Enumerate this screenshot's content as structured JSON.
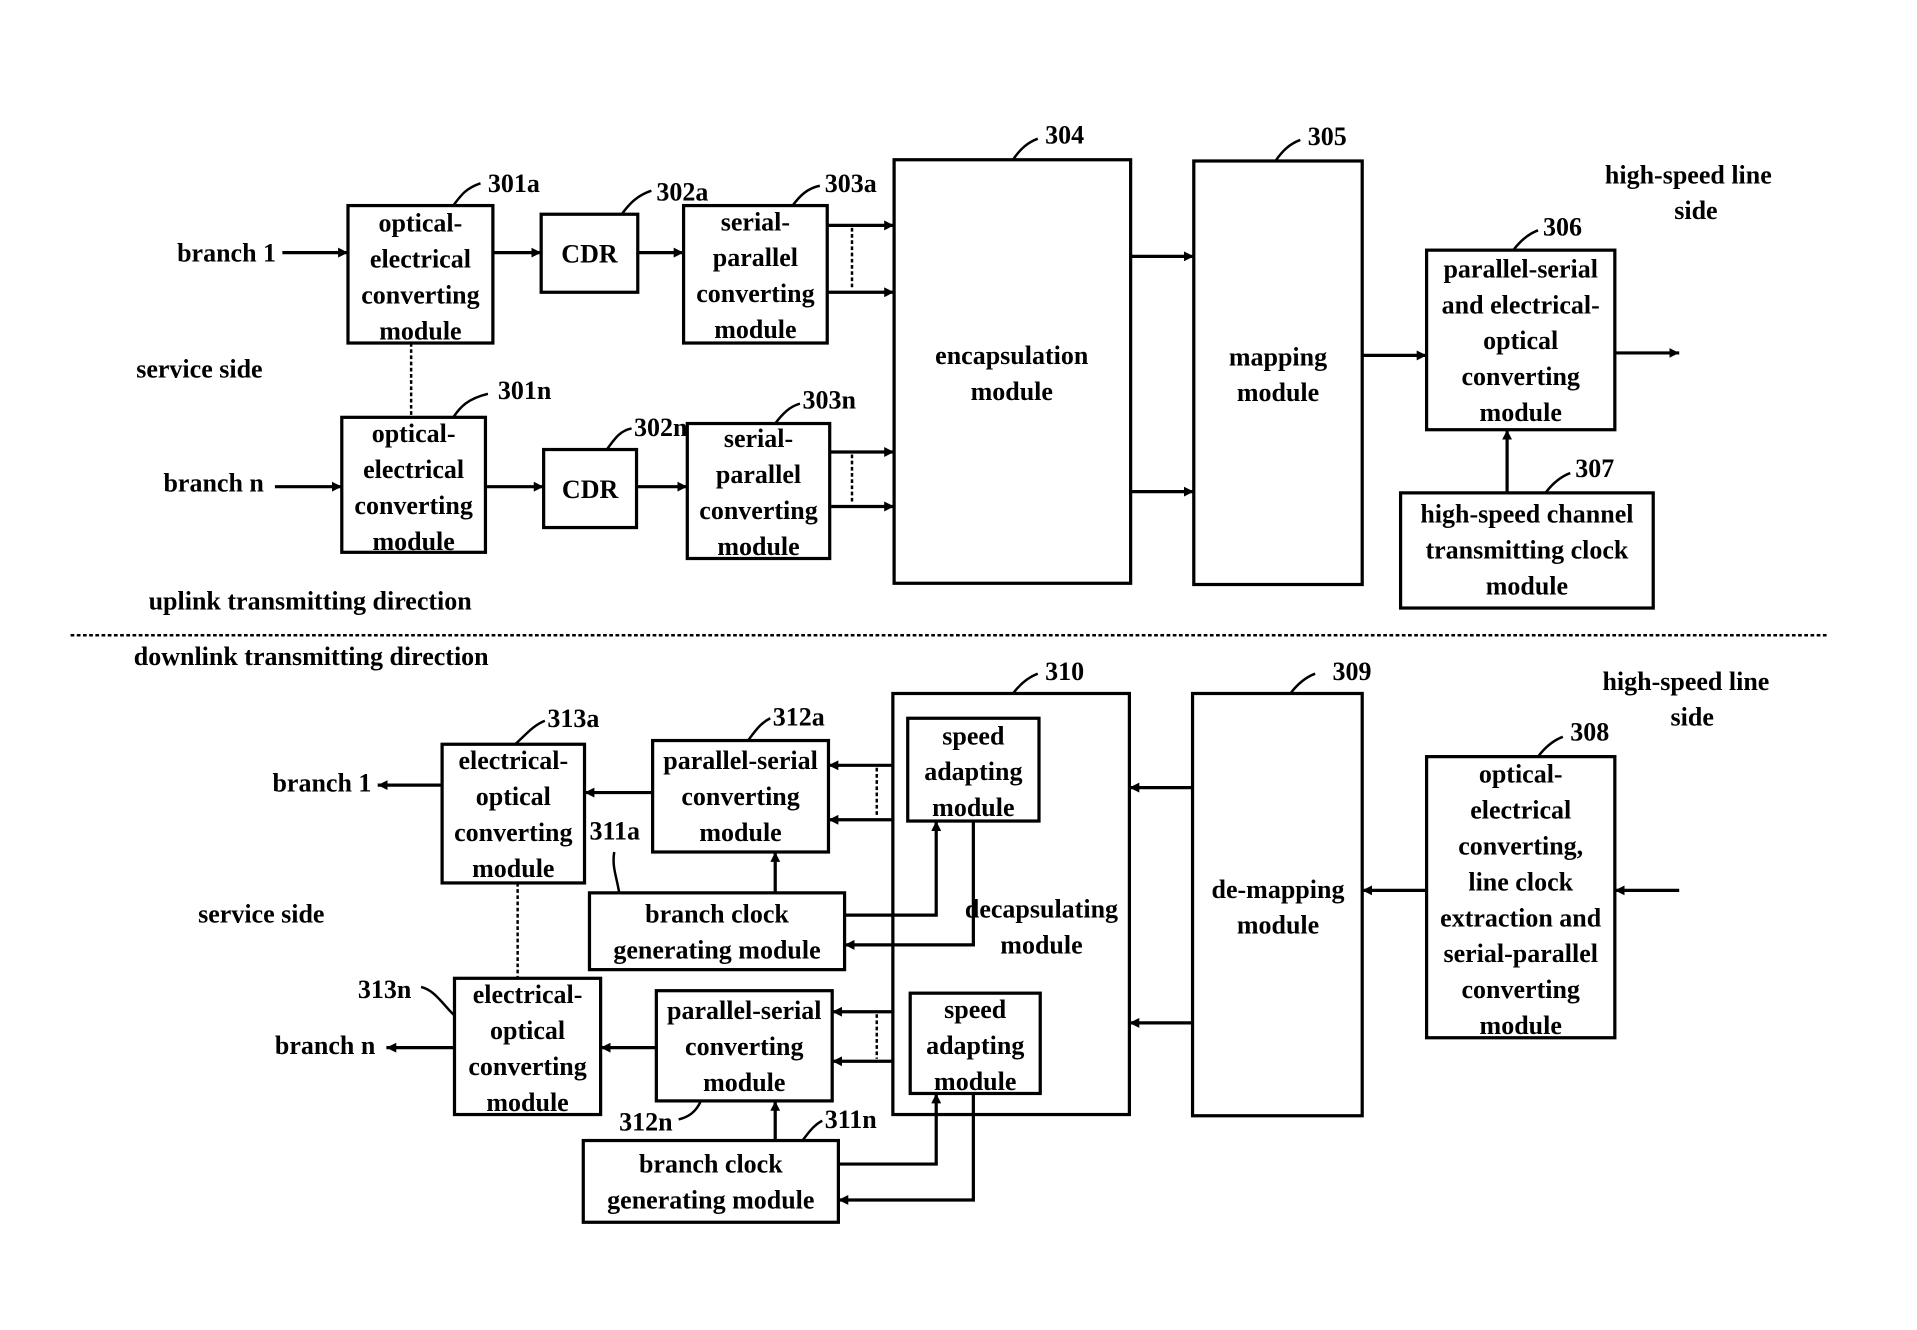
{
  "figure": {
    "uplink": {
      "direction_label": "uplink transmitting direction",
      "service_side_label": "service side",
      "line_side_label": [
        "high-speed line",
        "side"
      ],
      "branch_first": "branch 1",
      "branch_last": "branch n",
      "modules": {
        "oe_a": {
          "ref": "301a",
          "lines": [
            "optical-",
            "electrical",
            "converting",
            "module"
          ]
        },
        "oe_n": {
          "ref": "301n",
          "lines": [
            "optical-",
            "electrical",
            "converting",
            "module"
          ]
        },
        "cdr_a": {
          "ref": "302a",
          "lines": [
            "CDR"
          ]
        },
        "cdr_n": {
          "ref": "302n",
          "lines": [
            "CDR"
          ]
        },
        "sp_a": {
          "ref": "303a",
          "lines": [
            "serial-",
            "parallel",
            "converting",
            "module"
          ]
        },
        "sp_n": {
          "ref": "303n",
          "lines": [
            "serial-",
            "parallel",
            "converting",
            "module"
          ]
        },
        "encap": {
          "ref": "304",
          "lines": [
            "encapsulation",
            "module"
          ]
        },
        "mapping": {
          "ref": "305",
          "lines": [
            "mapping",
            "module"
          ]
        },
        "ps_eo": {
          "ref": "306",
          "lines": [
            "parallel-serial",
            "and electrical-",
            "optical",
            "converting",
            "module"
          ]
        },
        "clock": {
          "ref": "307",
          "lines": [
            "high-speed channel",
            "transmitting clock",
            "module"
          ]
        }
      }
    },
    "downlink": {
      "direction_label": "downlink transmitting direction",
      "service_side_label": "service side",
      "line_side_label": [
        "high-speed line",
        "side"
      ],
      "branch_first": "branch 1",
      "branch_last": "branch n",
      "modules": {
        "eo_a": {
          "ref": "313a",
          "lines": [
            "electrical-",
            "optical",
            "converting",
            "module"
          ]
        },
        "eo_n": {
          "ref": "313n",
          "lines": [
            "electrical-",
            "optical",
            "converting",
            "module"
          ]
        },
        "ps_a": {
          "ref": "312a",
          "lines": [
            "parallel-serial",
            "converting",
            "module"
          ]
        },
        "ps_n": {
          "ref": "312n",
          "lines": [
            "parallel-serial",
            "converting",
            "module"
          ]
        },
        "bclk_a": {
          "ref": "311a",
          "lines": [
            "branch clock",
            "generating module"
          ]
        },
        "bclk_n": {
          "ref": "311n",
          "lines": [
            "branch clock",
            "generating module"
          ]
        },
        "decap": {
          "ref": "310",
          "lines": [
            "decapsulating",
            "module"
          ]
        },
        "speed_a": {
          "lines": [
            "speed",
            "adapting",
            "module"
          ]
        },
        "speed_n": {
          "lines": [
            "speed",
            "adapting",
            "module"
          ]
        },
        "demap": {
          "ref": "309",
          "lines": [
            "de-mapping",
            "module"
          ]
        },
        "oe_line": {
          "ref": "308",
          "lines": [
            "optical-",
            "electrical",
            "converting,",
            "line clock",
            "extraction and",
            "serial-parallel",
            "converting",
            "module"
          ]
        }
      }
    }
  }
}
